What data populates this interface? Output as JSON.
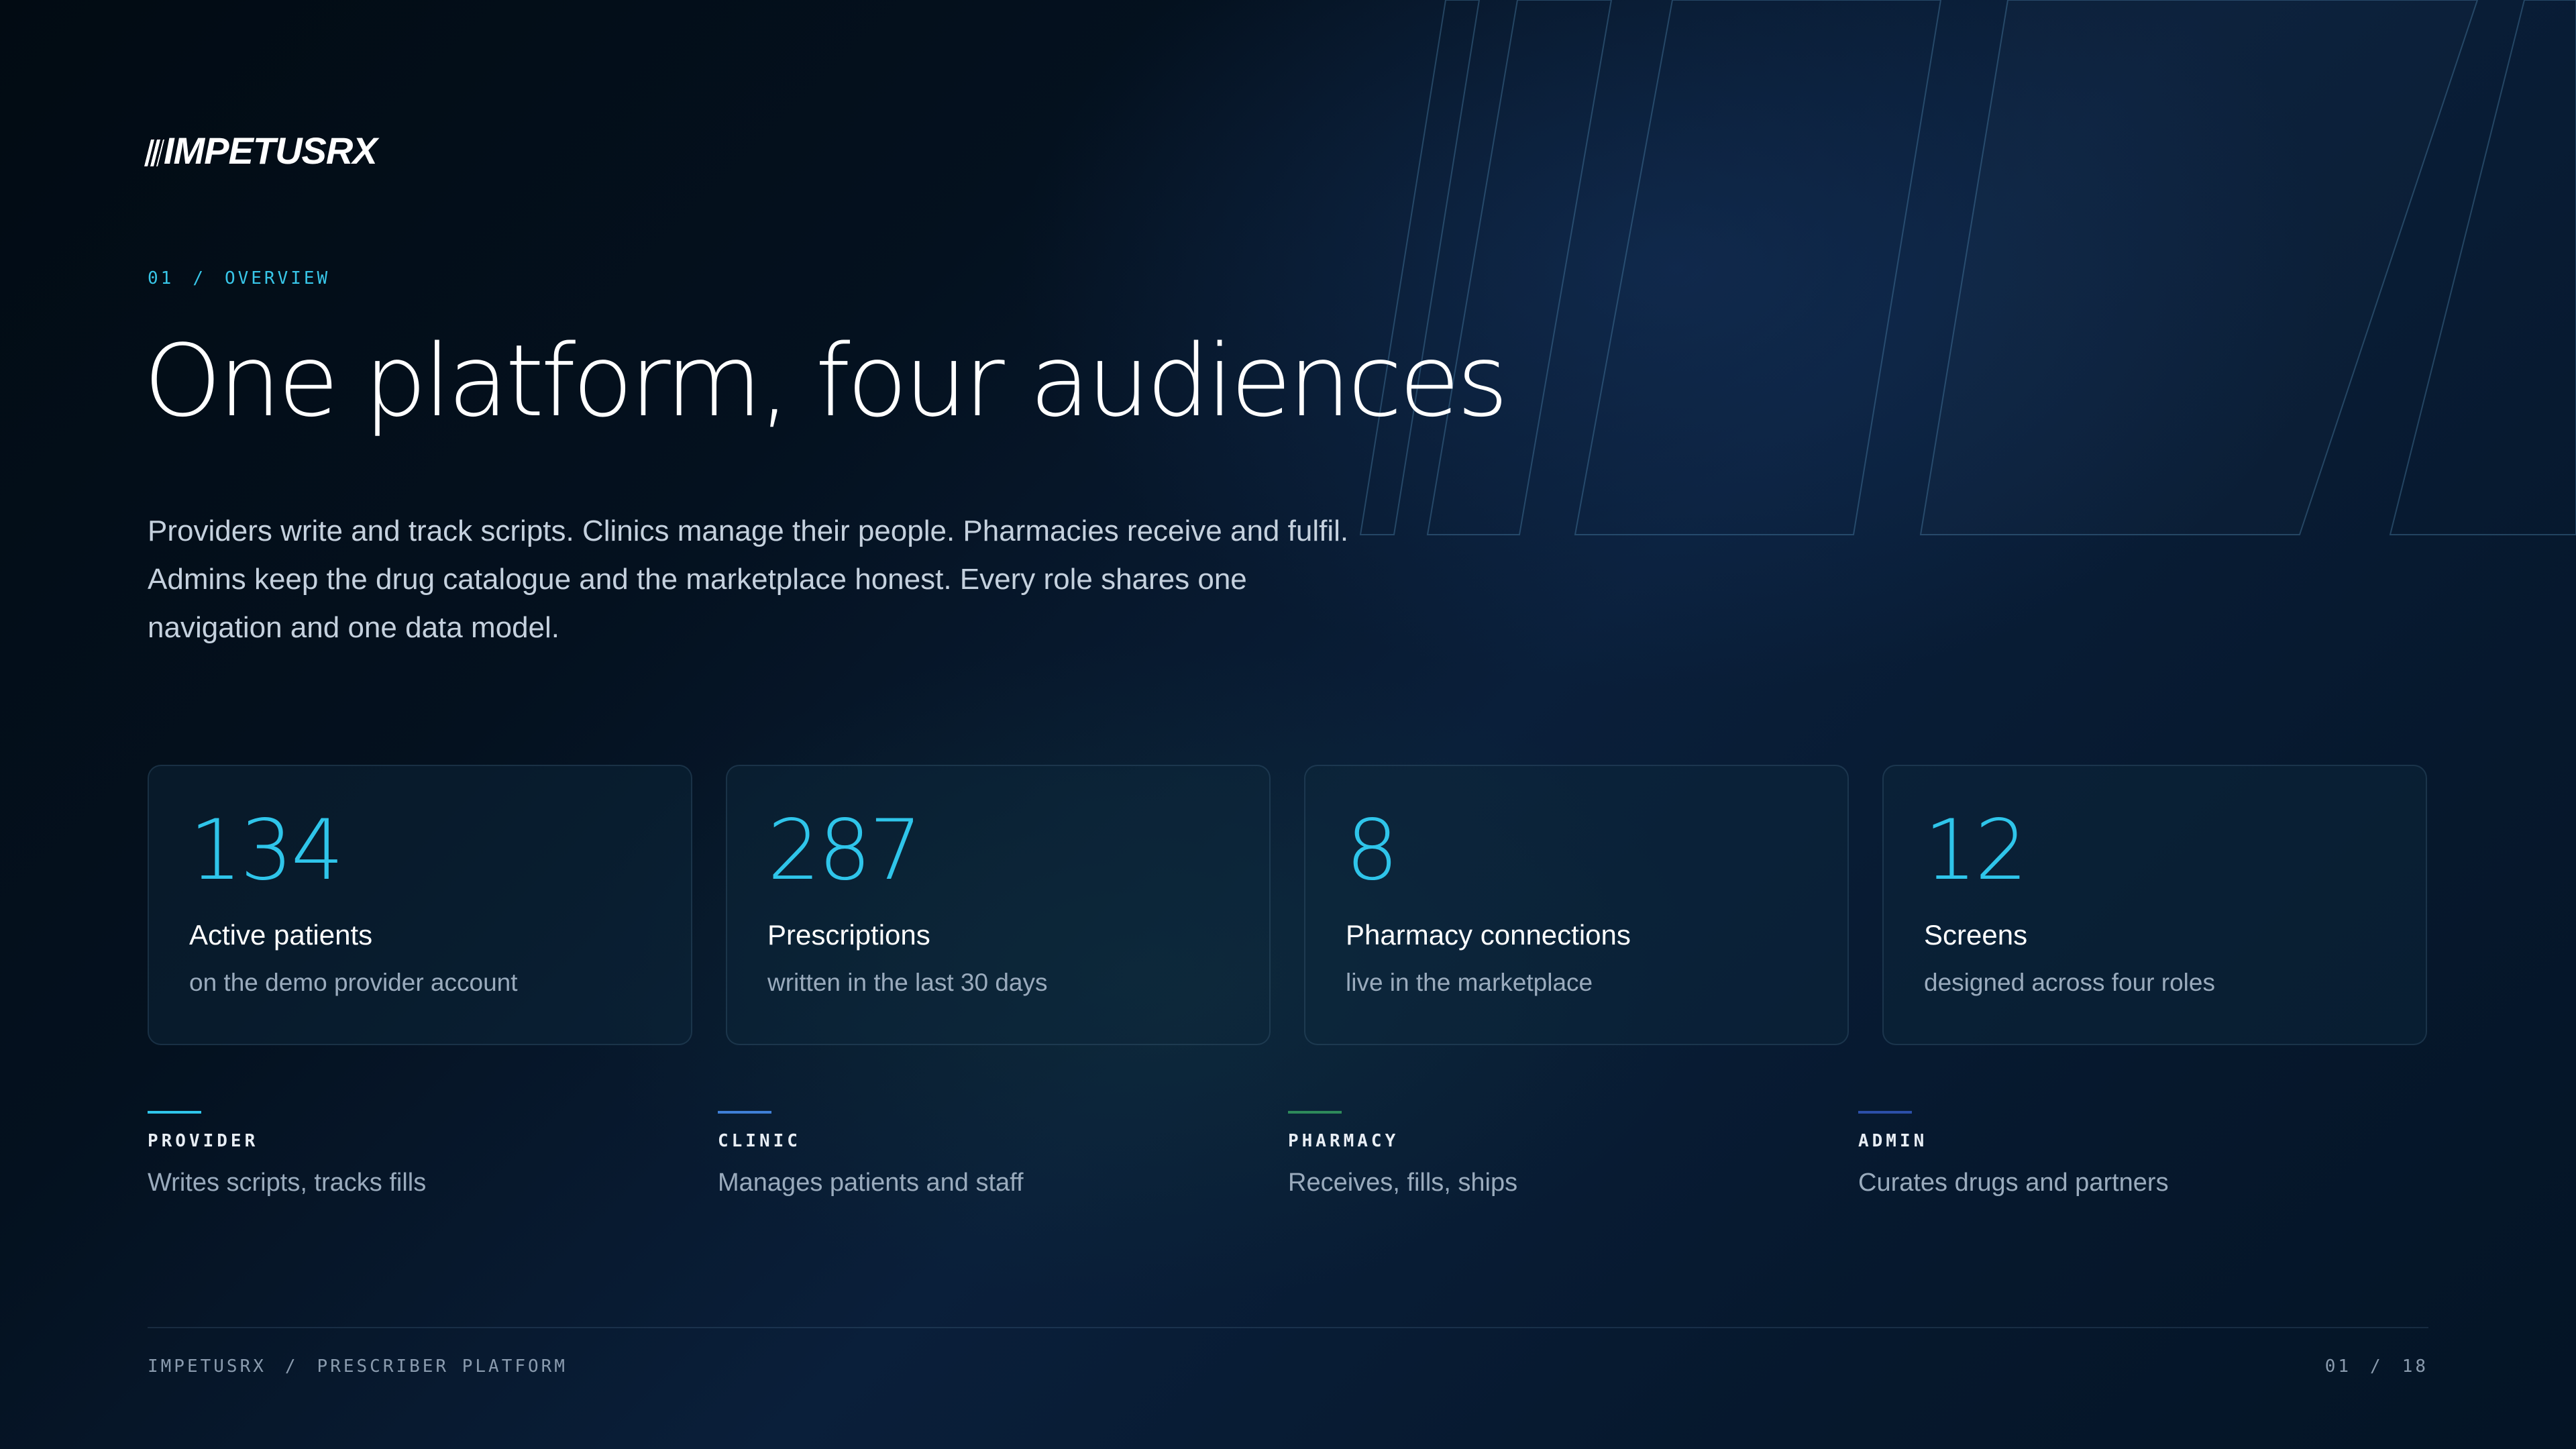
{
  "brand": {
    "logo_text": "IMPETUSRX"
  },
  "eyebrow": {
    "section": "01",
    "label": "OVERVIEW"
  },
  "title": "One platform, four audiences",
  "lede": "Providers write and track scripts. Clinics manage their people. Pharmacies receive and fulfil. Admins keep the drug catalogue and the marketplace honest. Every role shares one navigation and one data model.",
  "stats": [
    {
      "value": "134",
      "label": "Active patients",
      "sub": "on the demo provider account"
    },
    {
      "value": "287",
      "label": "Prescriptions",
      "sub": "written in the last 30 days"
    },
    {
      "value": "8",
      "label": "Pharmacy connections",
      "sub": "live in the marketplace"
    },
    {
      "value": "12",
      "label": "Screens",
      "sub": "designed across four roles"
    }
  ],
  "roles": [
    {
      "name": "PROVIDER",
      "desc": "Writes scripts, tracks fills",
      "color": "#2fc5ea"
    },
    {
      "name": "CLINIC",
      "desc": "Manages patients and staff",
      "color": "#3f7fd6"
    },
    {
      "name": "PHARMACY",
      "desc": "Receives, fills, ships",
      "color": "#2e8a5a"
    },
    {
      "name": "ADMIN",
      "desc": "Curates drugs and partners",
      "color": "#2c4fa8"
    }
  ],
  "footer": {
    "brand": "IMPETUSRX",
    "product": "PRESCRIBER PLATFORM",
    "page": "01",
    "total": "18"
  },
  "colors": {
    "accent": "#2fc5ea",
    "background": "#04111f"
  }
}
